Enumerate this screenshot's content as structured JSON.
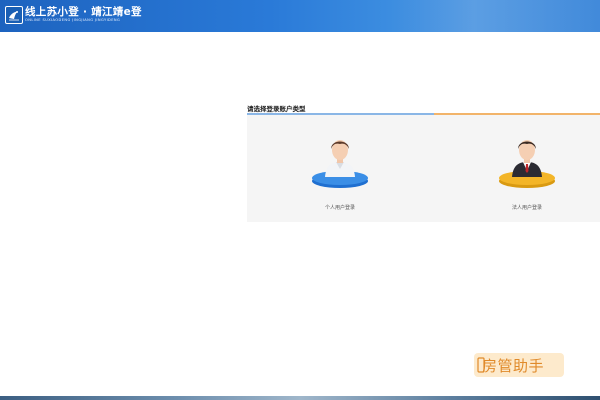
{
  "header": {
    "title": "线上苏小登 · 靖江靖e登",
    "subtitle": "ONLINE   SUXIAODENG   JINGJIANG   JINGYIDENG",
    "logo_icon": "bird-emblem-icon"
  },
  "main": {
    "section_title": "请选择登录账户类型",
    "accounts": [
      {
        "label": "个人用户登录",
        "icon": "personal-user-avatar-icon",
        "accent": "#3a8ee6"
      },
      {
        "label": "法人用户登录",
        "icon": "corporate-user-avatar-icon",
        "accent": "#f3b528"
      }
    ]
  },
  "watermark": {
    "text": "房管助手"
  },
  "colors": {
    "header_blue": "#2a7ad8",
    "bar_blue": "#8ab6e6",
    "bar_orange": "#f2b46a",
    "panel_bg": "#f5f5f5"
  }
}
